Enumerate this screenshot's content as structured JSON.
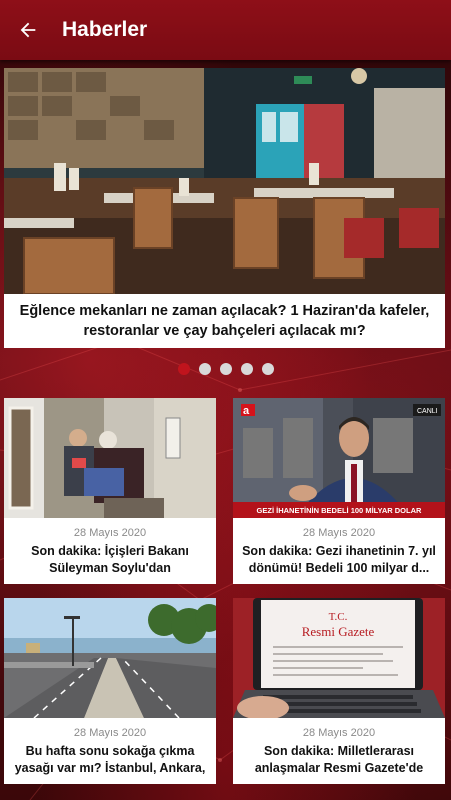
{
  "header": {
    "title": "Haberler"
  },
  "hero": {
    "title": "Eğlence mekanları ne zaman açılacak? 1 Haziran'da kafeler, restoranlar ve çay bahçeleri açılacak mı?"
  },
  "pagination": {
    "count": 5,
    "active": 0
  },
  "cards": [
    {
      "date": "28 Mayıs 2020",
      "title": "Son dakika: İçişleri Bakanı Süleyman Soylu'dan duygulandı..."
    },
    {
      "date": "28 Mayıs 2020",
      "title": "Son dakika: Gezi ihanetinin 7. yıl dönümü! Bedeli 100 milyar d...",
      "banner": "GEZİ İHANETİNİN BEDELİ 100 MİLYAR DOLAR",
      "live_label": "CANLI",
      "channel": "a"
    },
    {
      "date": "28 Mayıs 2020",
      "title": "Bu hafta sonu sokağa çıkma yasağı var mı? İstanbul, Ankara, ..."
    },
    {
      "date": "28 Mayıs 2020",
      "title": "Son dakika: Milletlerarası anlaşmalar Resmi Gazete'de yay...",
      "paper_line1": "T.C.",
      "paper_line2": "Resmi Gazete"
    }
  ],
  "colors": {
    "brand": "#8e0f18",
    "accent": "#c0141d"
  }
}
